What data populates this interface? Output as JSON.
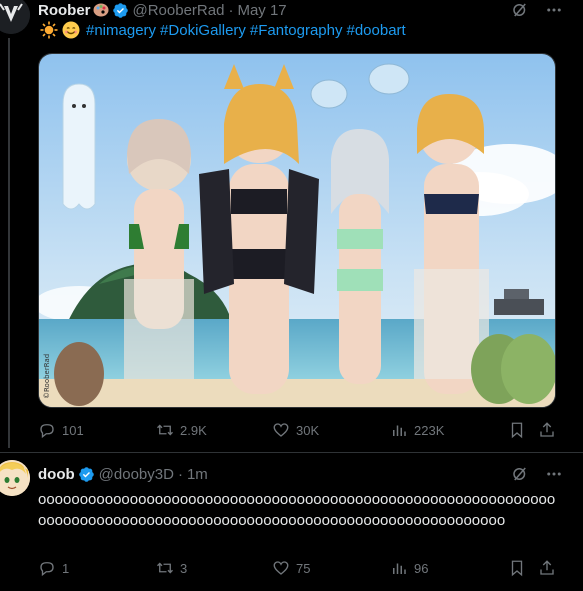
{
  "tweet1": {
    "author_name": "Roober",
    "handle": "@RooberRad",
    "separator": "·",
    "date": "May 17",
    "hashtags": [
      "#nimagery",
      "#DokiGallery",
      "#Fantography",
      "#doobart"
    ],
    "image_signature": "©RooberRad",
    "stats": {
      "replies": "101",
      "reposts": "2.9K",
      "likes": "30K",
      "views": "223K"
    }
  },
  "tweet2": {
    "author_name": "doob",
    "handle": "@dooby3D",
    "separator": "·",
    "date": "1m",
    "body": "oooooooooooooooooooooooooooooooooooooooooooooooooooooooooooooooooooooooooooooooooooooooooooooooooooooooooooooooooooooo",
    "stats": {
      "replies": "1",
      "reposts": "3",
      "likes": "75",
      "views": "96"
    }
  },
  "icons": {
    "verified": "verified-badge-icon",
    "grok": "grok-icon",
    "more": "more-icon",
    "reply": "reply-icon",
    "repost": "repost-icon",
    "like": "like-icon",
    "views": "views-icon",
    "bookmark": "bookmark-icon",
    "share": "share-icon"
  },
  "colors": {
    "background": "#000000",
    "text": "#e7e9ea",
    "muted": "#71767b",
    "link": "#1d9bf0",
    "verified": "#1d9bf0",
    "divider": "#2f3336"
  }
}
